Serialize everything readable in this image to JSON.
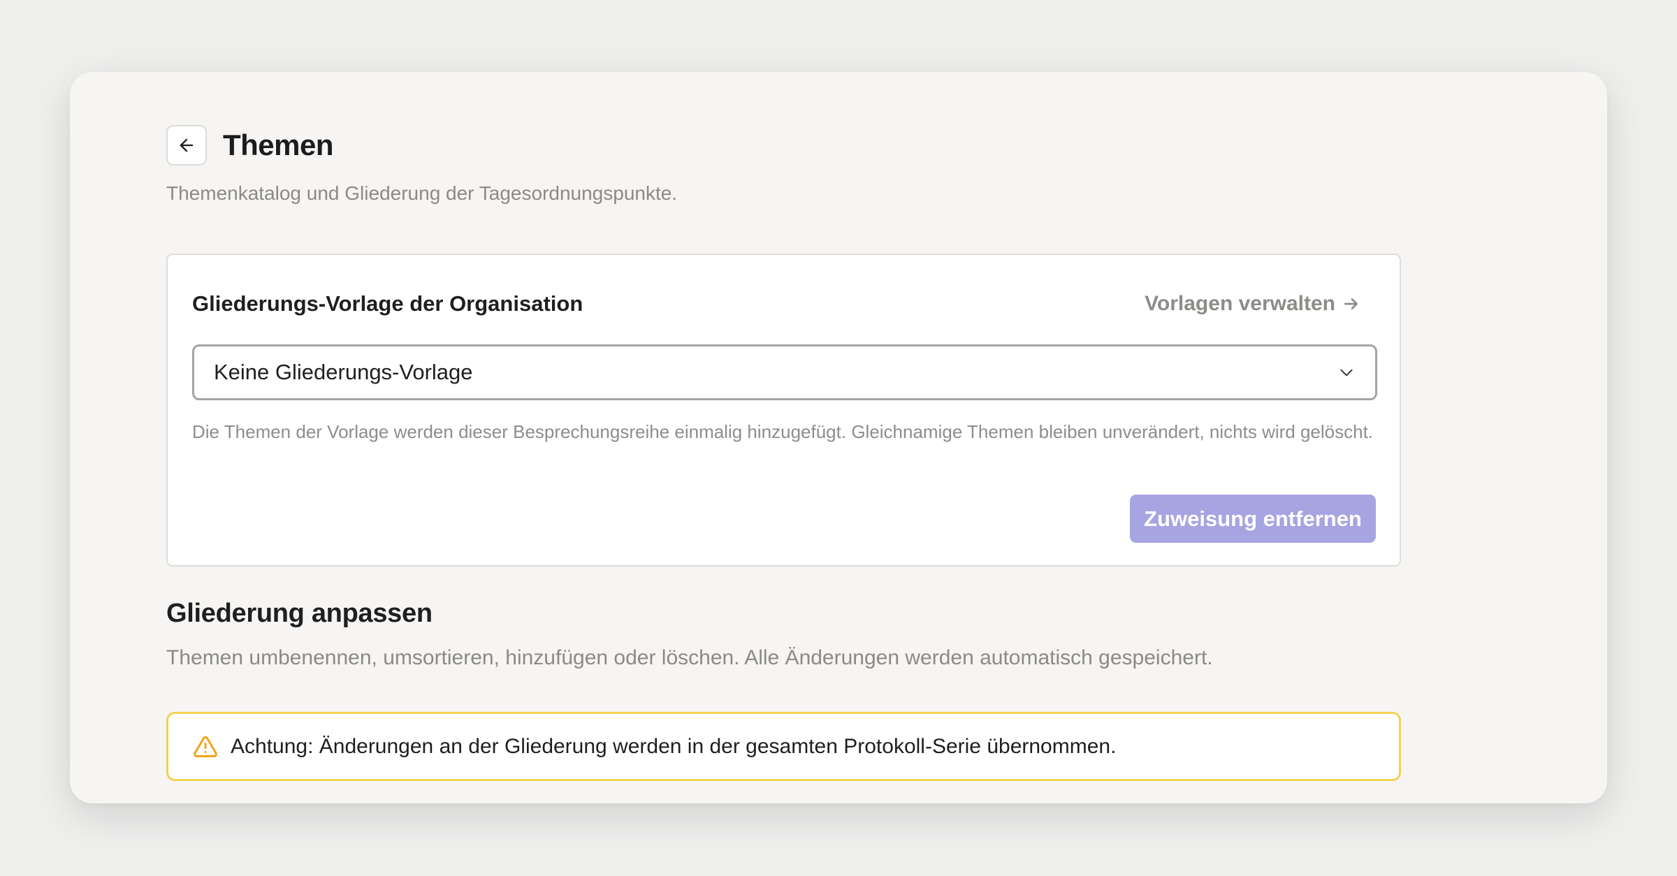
{
  "header": {
    "back_icon": "arrow-left-icon",
    "title": "Themen",
    "subtitle": "Themenkatalog und Gliederung der Tagesordnungspunkte."
  },
  "template_card": {
    "title": "Gliederungs-Vorlage der Organisation",
    "manage_link_label": "Vorlagen verwalten",
    "manage_link_icon": "arrow-right-icon",
    "select": {
      "selected_value": "Keine Gliederungs-Vorlage",
      "icon": "chevron-down-icon"
    },
    "help_text": "Die Themen der Vorlage werden dieser Besprechungsreihe einmalig hinzugefügt. Gleichnamige Themen bleiben unverändert, nichts wird gelöscht.",
    "remove_button_label": "Zuweisung entfernen",
    "remove_button_color": "#a7a4e2"
  },
  "outline_section": {
    "title": "Gliederung anpassen",
    "description": "Themen umbenennen, umsortieren, hinzufügen oder löschen. Alle Änderungen werden automatisch gespeichert."
  },
  "warning": {
    "icon": "warning-triangle-icon",
    "text": "Achtung: Änderungen an der Gliederung werden in der gesamten Protokoll-Serie übernommen.",
    "border_color": "#f1d253",
    "icon_color": "#f0a31c"
  }
}
